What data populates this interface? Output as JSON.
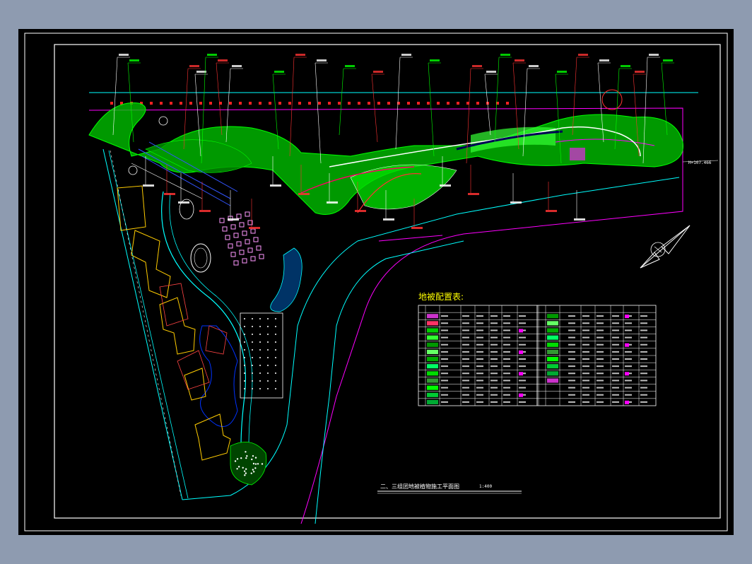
{
  "drawing": {
    "legend_title": "地被配置表:",
    "plan_title": "二、三组团地被植物施工平面图",
    "scale": "1:400",
    "elevation_tag": "H=107.466"
  },
  "colors": {
    "background": "#000000",
    "frame": "#ffffff",
    "green": "#00ff00",
    "cyan": "#00ffff",
    "magenta": "#ff00ff",
    "red": "#ff0000",
    "yellow": "#ffff00",
    "blue": "#0000ff"
  }
}
